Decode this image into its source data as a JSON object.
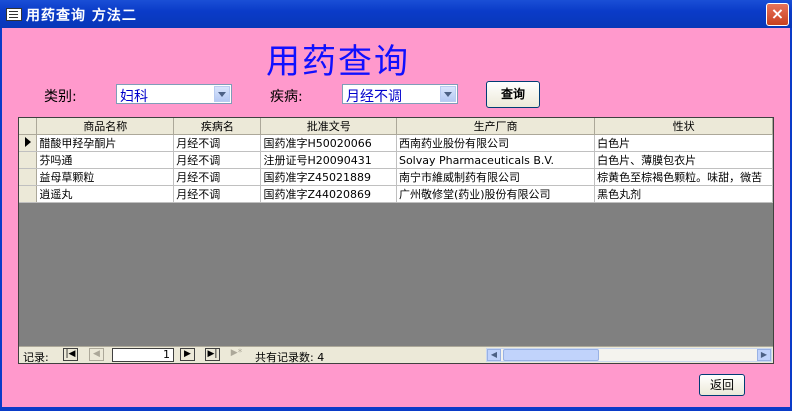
{
  "window": {
    "title": "用药查询 方法二",
    "close_symbol": "×"
  },
  "heading": "用药查询",
  "filters": {
    "category_label": "类别:",
    "category_value": "妇科",
    "disease_label": "疾病:",
    "disease_value": "月经不调",
    "query_button": "查询"
  },
  "table": {
    "columns": [
      "商品名称",
      "疾病名",
      "批准文号",
      "生产厂商",
      "性状"
    ],
    "rows": [
      [
        "醋酸甲羟孕酮片",
        "月经不调",
        "国药准字H50020066",
        "西南药业股份有限公司",
        "白色片"
      ],
      [
        "芬吗通",
        "月经不调",
        "注册证号H20090431",
        "Solvay Pharmaceuticals B.V.",
        "白色片、薄膜包衣片"
      ],
      [
        "益母草颗粒",
        "月经不调",
        "国药准字Z45021889",
        "南宁市維威制药有限公司",
        "棕黄色至棕褐色颗粒。味甜，微苦"
      ],
      [
        "逍遥丸",
        "月经不调",
        "国药准字Z44020869",
        "广州敬修堂(药业)股份有限公司",
        "黑色丸剂"
      ]
    ]
  },
  "navigation": {
    "record_label": "记录:",
    "current_record": "1",
    "total_label": "共有记录数: 4",
    "first_icon": "first-record-icon",
    "prev_icon": "prev-record-icon",
    "next_icon": "next-record-icon",
    "last_icon": "last-record-icon",
    "new_icon": "new-record-icon"
  },
  "back_button": "返回",
  "colors": {
    "background": "#ff99cc",
    "heading": "#1010ff",
    "titlebar": "#0a3bc8"
  }
}
